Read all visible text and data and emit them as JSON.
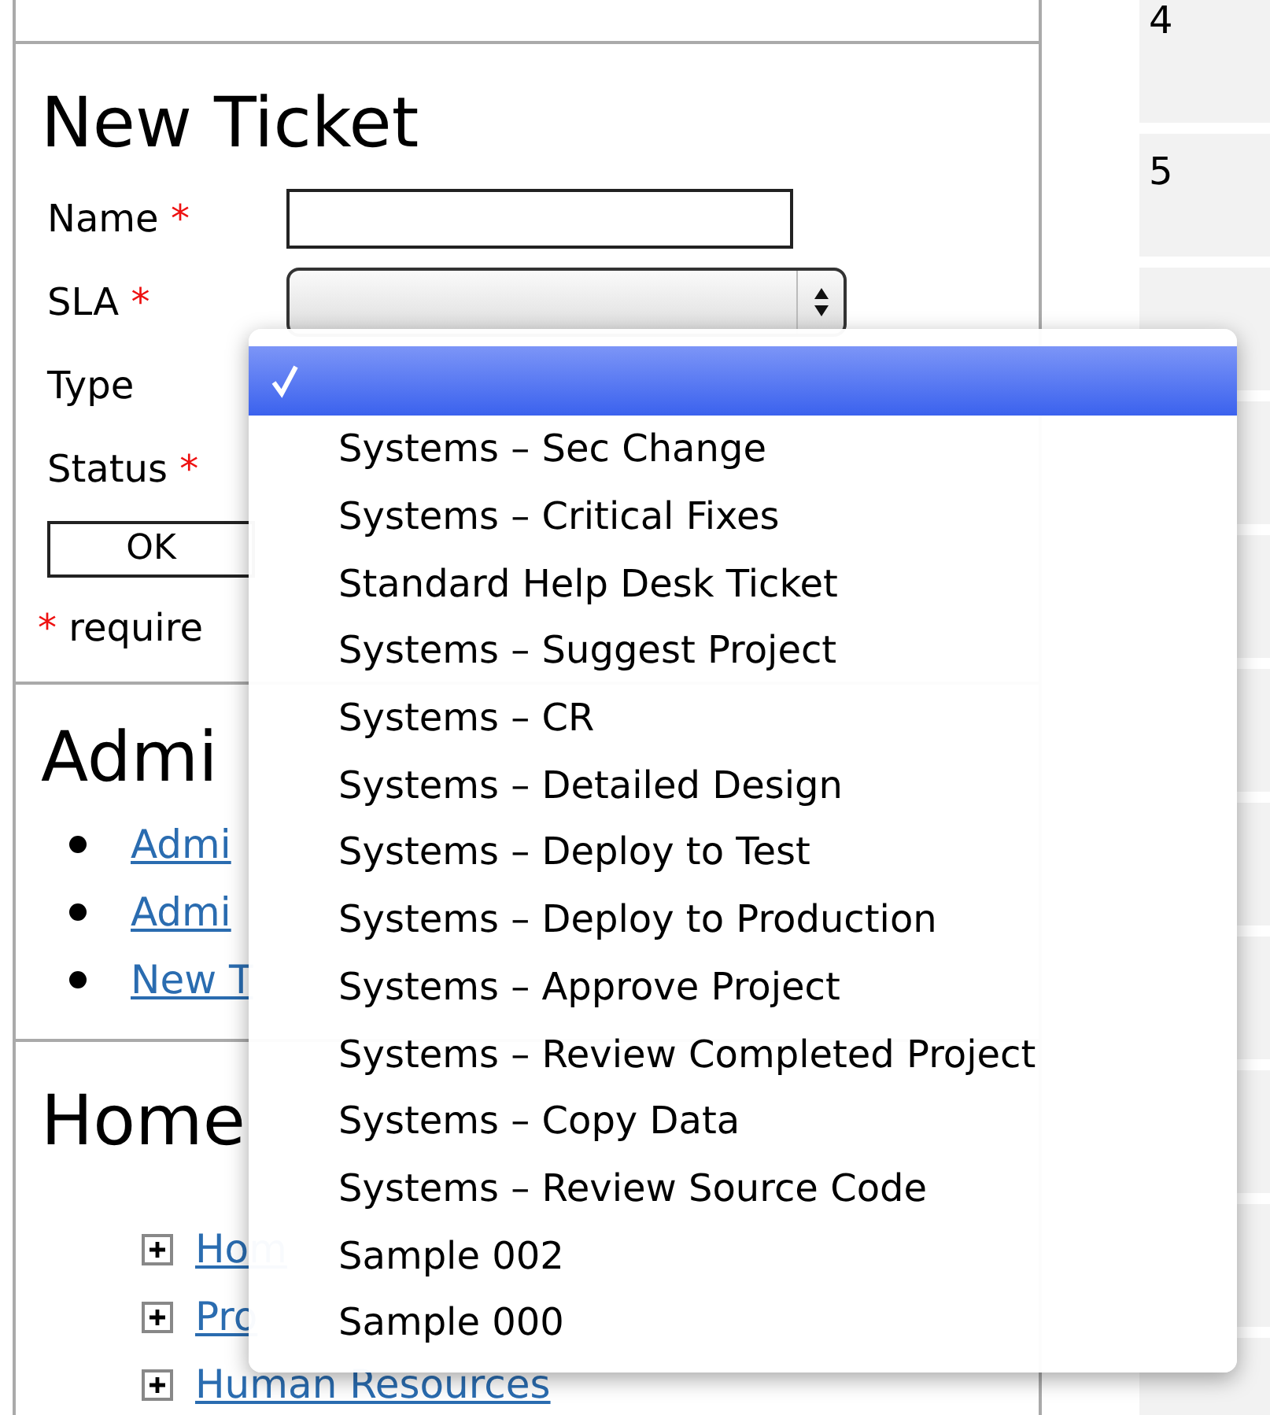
{
  "new_ticket": {
    "title": "New Ticket",
    "fields": [
      {
        "label": "Name",
        "marker": "*",
        "kind": "text"
      },
      {
        "label": "SLA",
        "marker": "*",
        "kind": "select"
      },
      {
        "label": "Type",
        "kind": "hidden"
      },
      {
        "label": "Status",
        "marker": "*",
        "kind": "hidden"
      }
    ],
    "ok_button": "OK",
    "note": {
      "marker": "*",
      "text": "require"
    }
  },
  "admin": {
    "title": "Admi",
    "links": [
      "Admi",
      "Admi",
      "New T"
    ]
  },
  "home": {
    "title": "Home",
    "tree": [
      {
        "label": "Hom",
        "expanded": false
      },
      {
        "label": "Pro",
        "expanded": false
      },
      {
        "label": "Human Resources",
        "expanded": false
      }
    ]
  },
  "right_column": {
    "rows": [
      "4",
      "5"
    ]
  },
  "dropdown": {
    "options": [
      {
        "selected": true
      },
      {
        "label": "Systems – Sec Change",
        "selected": false
      },
      {
        "label": "Systems – Critical Fixes",
        "selected": false
      },
      {
        "label": "Standard Help Desk Ticket",
        "selected": false
      },
      {
        "label": "Systems – Suggest Project",
        "selected": false
      },
      {
        "label": "Systems – CR",
        "selected": false
      },
      {
        "label": "Systems – Detailed Design",
        "selected": false
      },
      {
        "label": "Systems – Deploy to Test",
        "selected": false
      },
      {
        "label": "Systems – Deploy to Production",
        "selected": false
      },
      {
        "label": "Systems – Approve Project",
        "selected": false
      },
      {
        "label": "Systems – Review Completed Project",
        "selected": false
      },
      {
        "label": "Systems – Copy Data",
        "selected": false
      },
      {
        "label": "Systems – Review Source Code",
        "selected": false
      },
      {
        "label": "Sample 002",
        "selected": false
      },
      {
        "label": "Sample 000",
        "selected": false
      }
    ]
  }
}
